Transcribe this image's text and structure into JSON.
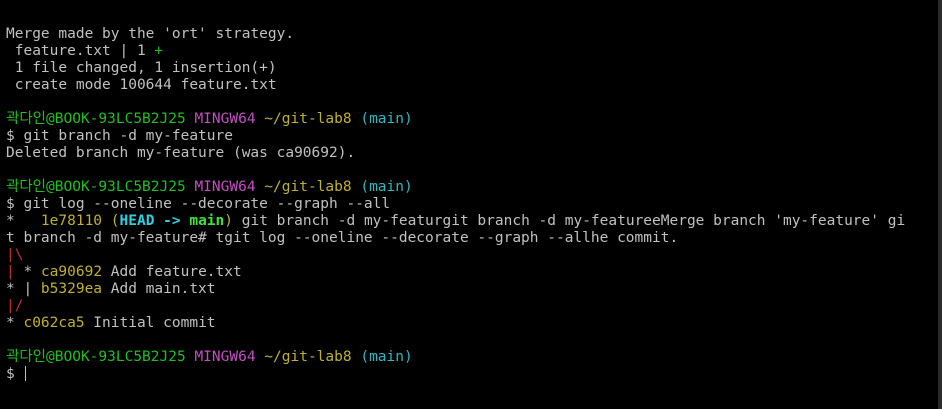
{
  "terminal": {
    "merge": {
      "line1": "Merge made by the 'ort' strategy.",
      "stat_file": " feature.txt | 1 ",
      "stat_plus": "+",
      "line3": " 1 file changed, 1 insertion(+)",
      "line4": " create mode 100644 feature.txt"
    },
    "prompt": {
      "user": "곽다인",
      "host": "@BOOK-93LC5B2J25",
      "shell": "MINGW64",
      "path": "~/git-lab8",
      "branch": "(main)",
      "sign": "$"
    },
    "cmd1": " git branch -d my-feature",
    "out1": "Deleted branch my-feature (was ca90692).",
    "cmd2": " git log --oneline --decorate --graph --all",
    "log": {
      "row1_graph": "*   ",
      "row1_hash": "1e78110",
      "row1_open": " (",
      "row1_head": "HEAD -> ",
      "row1_main": "main",
      "row1_close": ")",
      "row1_msg": " git branch -d my-featurgit branch -d my-featureeMerge branch 'my-feature' gi",
      "row1_wrap": "t branch -d my-feature# tgit log --oneline --decorate --graph --allhe commit.",
      "row2_graph": "|\\",
      "row3_pipe": "|",
      "row3_star": " * ",
      "row3_hash": "ca90692",
      "row3_msg": " Add feature.txt",
      "row4_graph": "* | ",
      "row4_hash": "b5329ea",
      "row4_msg": " Add main.txt",
      "row5_graph": "|/",
      "row6_graph": "* ",
      "row6_hash": "c062ca5",
      "row6_msg": " Initial commit"
    }
  }
}
